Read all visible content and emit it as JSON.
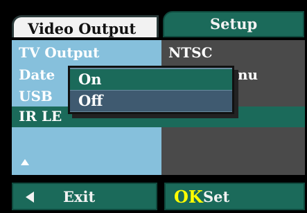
{
  "tabs": {
    "video_output": "Video Output",
    "setup": "Setup"
  },
  "menu": {
    "rows": [
      {
        "label": "TV Output",
        "value": "NTSC"
      },
      {
        "label": "Date",
        "value": "nu"
      },
      {
        "label": "USB",
        "value": ""
      },
      {
        "label": "IR LE",
        "value": ""
      }
    ]
  },
  "popup": {
    "options": [
      "On",
      "Off"
    ],
    "selected": "On"
  },
  "footer": {
    "exit_label": "Exit",
    "ok_label": "OK",
    "set_label": "Set"
  },
  "colors": {
    "accent_green": "#1b6a5a",
    "left_panel": "#86c0dc",
    "right_panel": "#4a4a4a",
    "ok_yellow": "#ffff00"
  },
  "icons": {
    "exit": "left-arrow-icon",
    "scroll": "up-arrow-icon"
  }
}
